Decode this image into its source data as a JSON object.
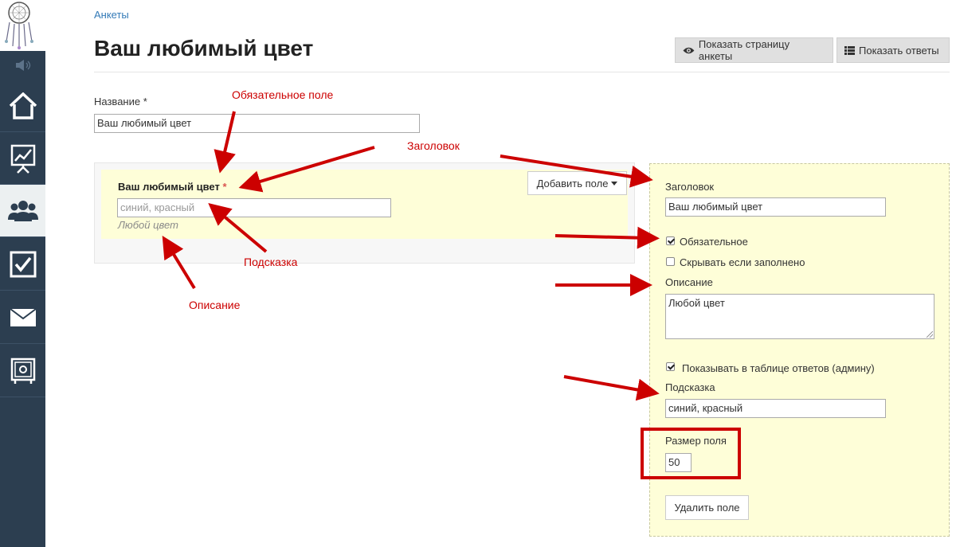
{
  "breadcrumb": "Анкеты",
  "page_title": "Ваш любимый цвет",
  "header_buttons": {
    "show_page": "Показать страницу анкеты",
    "show_answers": "Показать ответы"
  },
  "name_field": {
    "label": "Название *",
    "value": "Ваш любимый цвет"
  },
  "preview": {
    "field_label": "Ваш любимый цвет",
    "required_mark": "*",
    "placeholder": "синий, красный",
    "description": "Любой цвет",
    "add_field_button": "Добавить поле"
  },
  "settings": {
    "title_label": "Заголовок",
    "title_value": "Ваш любимый цвет",
    "required_label": "Обязательное",
    "required_checked": true,
    "hide_if_filled_label": "Скрывать если заполнено",
    "hide_if_filled_checked": false,
    "description_label": "Описание",
    "description_value": "Любой цвет",
    "show_in_table_label": "Показывать в таблице ответов (админу)",
    "show_in_table_checked": true,
    "hint_label": "Подсказка",
    "hint_value": "синий, красный",
    "size_label": "Размер поля",
    "size_value": "50",
    "delete_button": "Удалить поле"
  },
  "annotations": {
    "required_field": "Обязательное поле",
    "heading": "Заголовок",
    "hint": "Подсказка",
    "description": "Описание"
  },
  "colors": {
    "sidebar": "#2c3e50",
    "link": "#337ab7",
    "highlight": "#fefed8",
    "annotation": "#cc0000"
  }
}
